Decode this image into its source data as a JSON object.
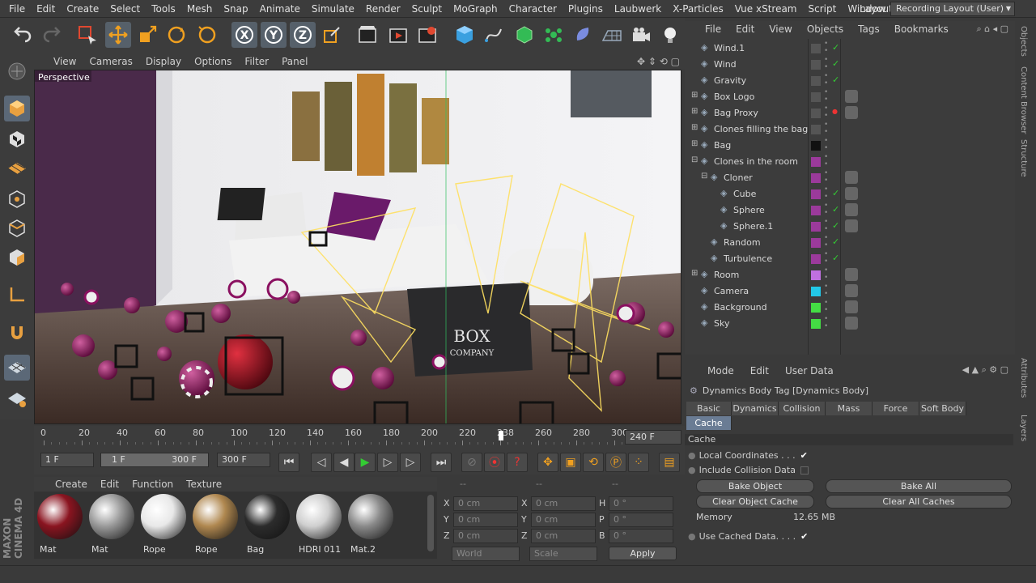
{
  "menu": [
    "File",
    "Edit",
    "Create",
    "Select",
    "Tools",
    "Mesh",
    "Snap",
    "Animate",
    "Simulate",
    "Render",
    "Sculpt",
    "MoGraph",
    "Character",
    "Plugins",
    "Laubwerk",
    "X-Particles",
    "Vue xStream",
    "Script",
    "Window",
    "Help"
  ],
  "layout": {
    "label": "Layout:",
    "value": "Recording Layout (User)"
  },
  "viewport": {
    "menu": [
      "View",
      "Cameras",
      "Display",
      "Options",
      "Filter",
      "Panel"
    ],
    "label": "Perspective",
    "logo_line1": "BOX",
    "logo_line2": "COMPANY"
  },
  "timeline": {
    "ticks": [
      "0",
      "20",
      "40",
      "60",
      "80",
      "100",
      "120",
      "140",
      "160",
      "180",
      "200",
      "220",
      "238",
      "260",
      "280",
      "300"
    ],
    "end_field": "240 F"
  },
  "transport": {
    "start": "1 F",
    "range_start": "1 F",
    "range_end": "300 F",
    "end": "300 F"
  },
  "materials": {
    "menu": [
      "Create",
      "Edit",
      "Function",
      "Texture"
    ],
    "items": [
      {
        "name": "Mat",
        "color": "#8a1420"
      },
      {
        "name": "Mat",
        "color": "#9a9a9a"
      },
      {
        "name": "Rope",
        "color": "#e8e8e8"
      },
      {
        "name": "Rope",
        "color": "#b08850"
      },
      {
        "name": "Bag",
        "color": "#2c2c2c"
      },
      {
        "name": "HDRI 011",
        "color": "#cfcfcf"
      },
      {
        "name": "Mat.2",
        "color": "#8a8a8a"
      }
    ]
  },
  "coords": {
    "header": [
      "--",
      "--",
      "--"
    ],
    "rows": [
      {
        "a": "X",
        "av": "0 cm",
        "b": "X",
        "bv": "0 cm",
        "c": "H",
        "cv": "0 °"
      },
      {
        "a": "Y",
        "av": "0 cm",
        "b": "Y",
        "bv": "0 cm",
        "c": "P",
        "cv": "0 °"
      },
      {
        "a": "Z",
        "av": "0 cm",
        "b": "Z",
        "bv": "0 cm",
        "c": "B",
        "cv": "0 °"
      }
    ],
    "world": "World",
    "scale": "Scale",
    "apply": "Apply"
  },
  "objects": {
    "menu": [
      "File",
      "Edit",
      "View",
      "Objects",
      "Tags",
      "Bookmarks"
    ],
    "rows": [
      {
        "name": "Wind.1",
        "indent": 0,
        "expand": "",
        "color": ""
      },
      {
        "name": "Wind",
        "indent": 0,
        "expand": "",
        "color": ""
      },
      {
        "name": "Gravity",
        "indent": 0,
        "expand": "",
        "color": ""
      },
      {
        "name": "Box Logo",
        "indent": 0,
        "expand": "+",
        "color": ""
      },
      {
        "name": "Bag Proxy",
        "indent": 0,
        "expand": "+",
        "color": ""
      },
      {
        "name": "Clones filling the bag",
        "indent": 0,
        "expand": "+",
        "color": ""
      },
      {
        "name": "Bag",
        "indent": 0,
        "expand": "+",
        "color": "#111111"
      },
      {
        "name": "Clones in the room",
        "indent": 0,
        "expand": "-",
        "color": "#9b3a9b"
      },
      {
        "name": "Cloner",
        "indent": 1,
        "expand": "-",
        "color": "#9b3a9b"
      },
      {
        "name": "Cube",
        "indent": 2,
        "expand": "",
        "color": "#9b3a9b"
      },
      {
        "name": "Sphere",
        "indent": 2,
        "expand": "",
        "color": "#9b3a9b"
      },
      {
        "name": "Sphere.1",
        "indent": 2,
        "expand": "",
        "color": "#9b3a9b"
      },
      {
        "name": "Random",
        "indent": 1,
        "expand": "",
        "color": "#9b3a9b"
      },
      {
        "name": "Turbulence",
        "indent": 1,
        "expand": "",
        "color": "#9b3a9b"
      },
      {
        "name": "Room",
        "indent": 0,
        "expand": "+",
        "color": "#c070e0"
      },
      {
        "name": "Camera",
        "indent": 0,
        "expand": "",
        "color": "#22c8e8"
      },
      {
        "name": "Background",
        "indent": 0,
        "expand": "",
        "color": "#44dd44"
      },
      {
        "name": "Sky",
        "indent": 0,
        "expand": "",
        "color": "#44dd44"
      }
    ]
  },
  "attributes": {
    "menu": [
      "Mode",
      "Edit",
      "User Data"
    ],
    "title": "Dynamics Body Tag [Dynamics Body]",
    "tabs": [
      "Basic",
      "Dynamics",
      "Collision",
      "Mass",
      "Force",
      "Soft Body"
    ],
    "active_tab": "Cache",
    "section": "Cache",
    "local_coords": "Local Coordinates . . .",
    "include_collision": "Include Collision Data",
    "bake_object": "Bake Object",
    "bake_all": "Bake All",
    "clear_object_cache": "Clear Object Cache",
    "clear_all_caches": "Clear All Caches",
    "memory_label": "Memory",
    "memory_value": "12.65 MB",
    "use_cached": "Use Cached Data. . . ."
  },
  "side_tabs": [
    "Objects",
    "Content Browser",
    "Structure",
    "Attributes",
    "Layers"
  ],
  "brand": "MAXON CINEMA 4D"
}
